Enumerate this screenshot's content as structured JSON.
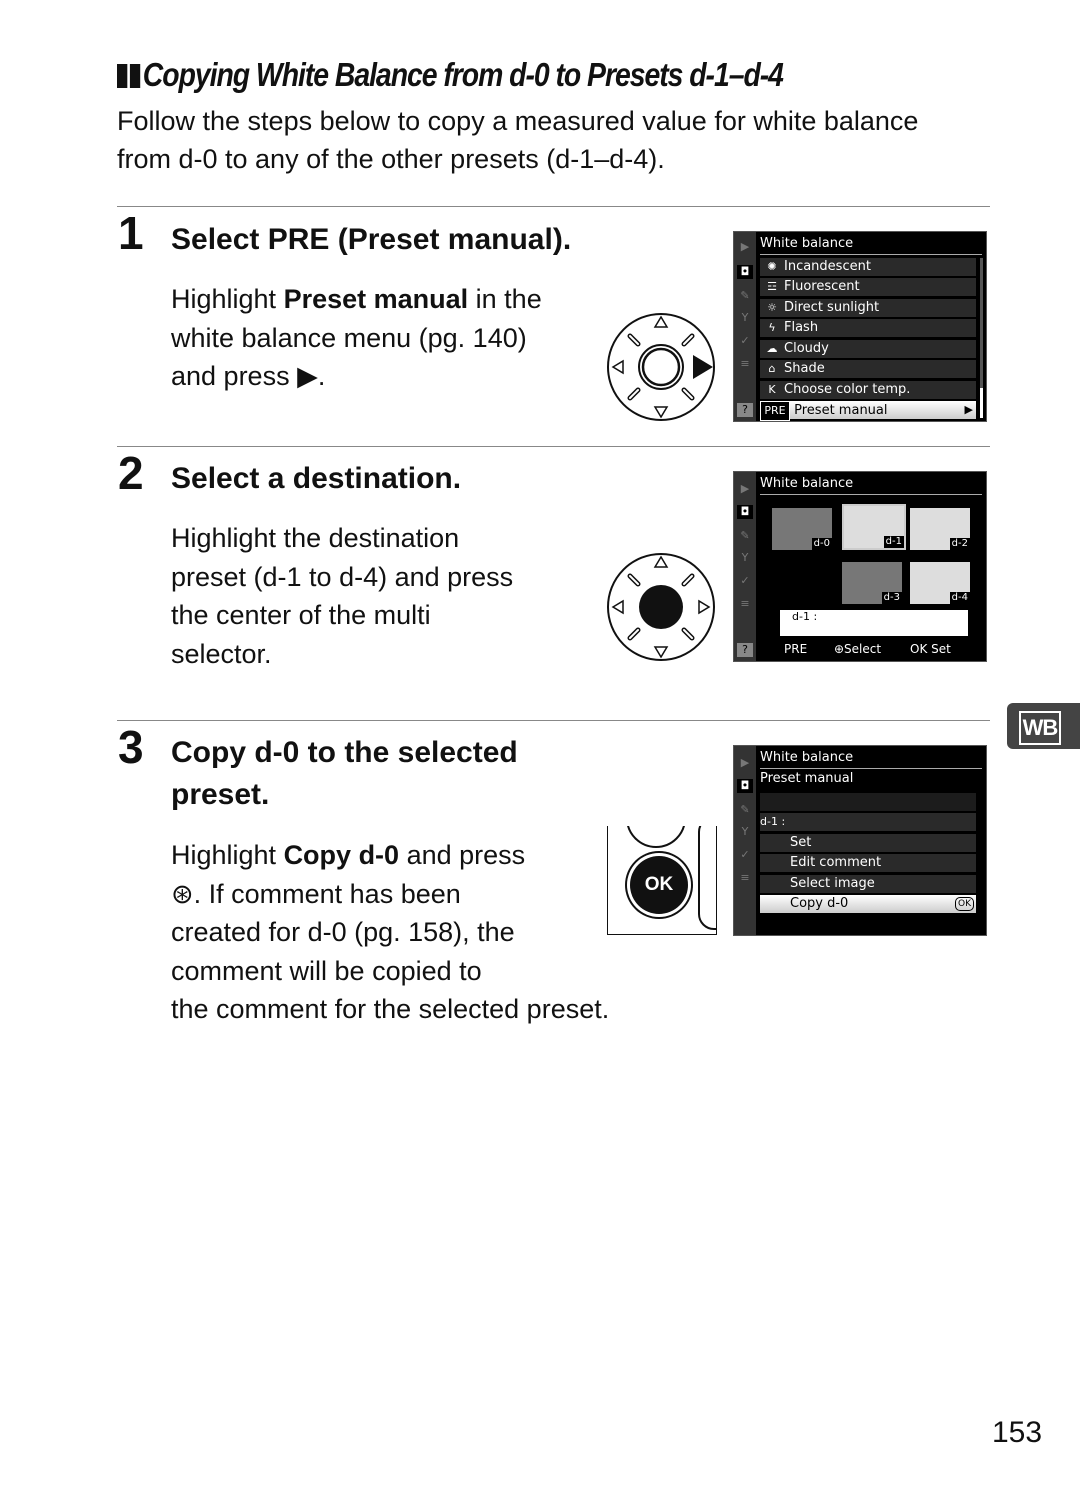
{
  "section_title": "Copying White Balance from d-0 to Presets d-1–d-4",
  "intro": "Follow the steps below to copy a measured value for white balance from d-0 to any of the other presets (d-1–d-4).",
  "steps": [
    {
      "number": "1",
      "heading_prefix": "Select PRE (",
      "heading_bold": "Preset manual",
      "heading_suffix": ").",
      "body_lines": [
        "Highlight ",
        "Preset manual",
        " in the",
        "white balance menu (pg. 140)",
        "and press ▶."
      ]
    },
    {
      "number": "2",
      "heading": "Select a destination.",
      "body_lines": [
        "Highlight the destination",
        "preset (d-1 to d-4) and press",
        "the center of the multi",
        "selector."
      ]
    },
    {
      "number": "3",
      "heading_line1": "Copy d-0 to the selected",
      "heading_line2": "preset.",
      "body_lines": [
        "Highlight ",
        "Copy d-0",
        " and press",
        "⊛.  If comment has been",
        "created for d-0 (pg. 158), the",
        "comment will be copied to",
        "the comment for the selected preset."
      ]
    }
  ],
  "screens": {
    "wb_menu": {
      "title": "White balance",
      "items": [
        {
          "icon": "✺",
          "label": "Incandescent"
        },
        {
          "icon": "☲",
          "label": "Fluorescent"
        },
        {
          "icon": "☼",
          "label": "Direct sunlight"
        },
        {
          "icon": "ϟ",
          "label": "Flash"
        },
        {
          "icon": "☁",
          "label": "Cloudy"
        },
        {
          "icon": "⌂",
          "label": "Shade"
        },
        {
          "icon": "K",
          "label": "Choose color temp."
        },
        {
          "icon": "PRE",
          "label": "Preset manual",
          "selected": true
        }
      ]
    },
    "destination": {
      "title": "White balance",
      "thumbs": [
        "d-0",
        "d-1",
        "d-2",
        "d-3",
        "d-4"
      ],
      "comment_label": "d-1  :",
      "footer": {
        "pre": "PRE",
        "select": "⊕Select",
        "set": "OK Set"
      }
    },
    "preset_manual": {
      "title": "White balance",
      "subtitle": "Preset manual",
      "info_row": "d-1        :",
      "items": [
        "Set",
        "Edit comment",
        "Select image",
        "Copy d-0"
      ],
      "ok_badge": "OK"
    }
  },
  "ok_button_label": "OK",
  "side_tab": "WB",
  "page_number": "153"
}
